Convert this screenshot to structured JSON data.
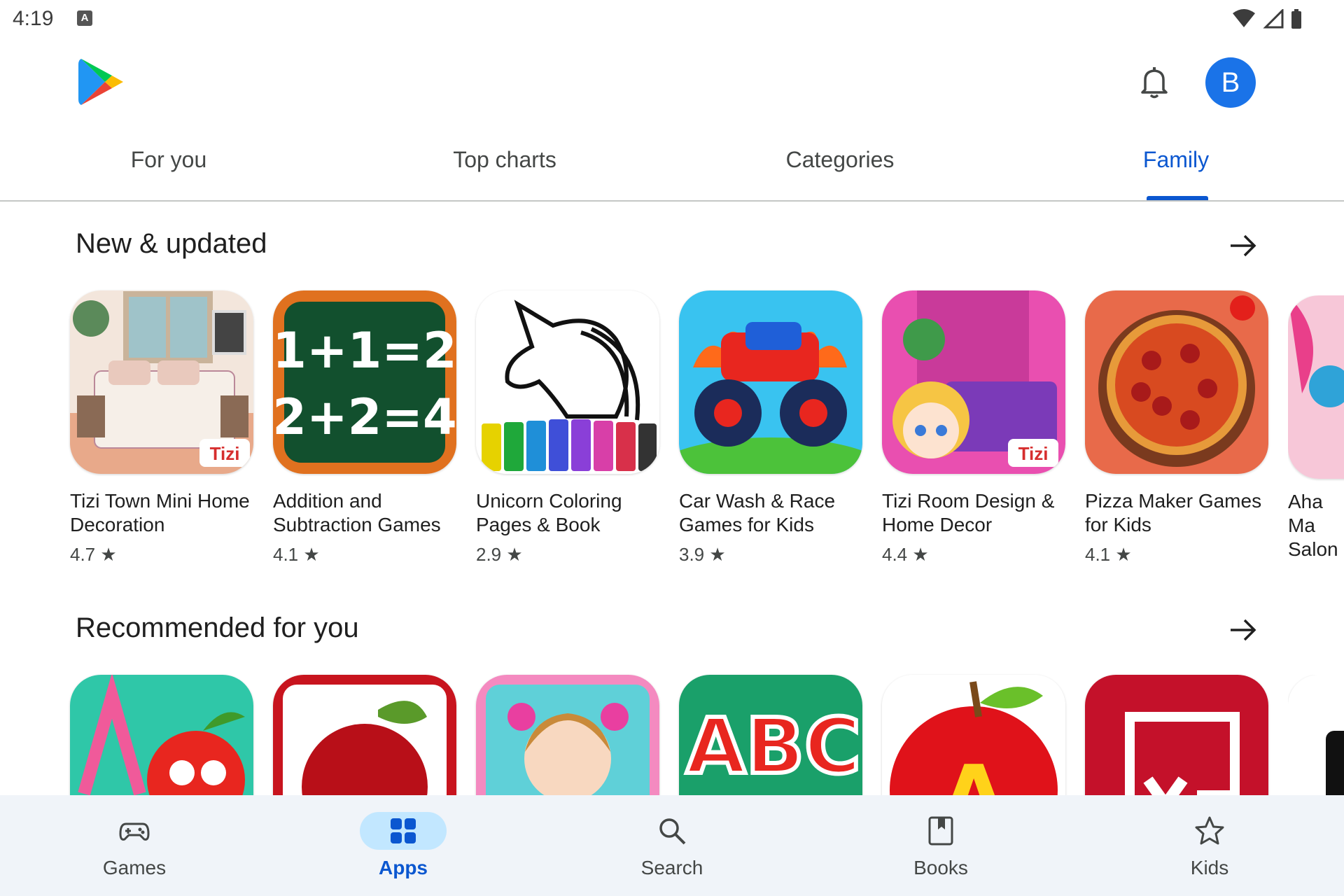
{
  "status": {
    "time": "4:19",
    "notif_letter": "A"
  },
  "header": {
    "avatar_letter": "B"
  },
  "tabs": [
    {
      "label": "For you"
    },
    {
      "label": "Top charts"
    },
    {
      "label": "Categories"
    },
    {
      "label": "Family"
    }
  ],
  "section1": {
    "title": "New & updated",
    "apps": [
      {
        "name": "Tizi Town Mini Home Decoration",
        "rating": "4.7 ★",
        "badge": "Tizi"
      },
      {
        "name": "Addition and Subtraction Games",
        "rating": "4.1 ★",
        "line1": "1+1=2",
        "line2": "2+2=4"
      },
      {
        "name": "Unicorn Coloring Pages & Book",
        "rating": "2.9 ★"
      },
      {
        "name": "Car Wash & Race Games for Kids",
        "rating": "3.9 ★"
      },
      {
        "name": "Tizi Room Design & Home Decor",
        "rating": "4.4 ★",
        "badge": "Tizi"
      },
      {
        "name": "Pizza Maker Games for Kids",
        "rating": "4.1 ★"
      },
      {
        "name": "Aha Ma Salon",
        "rating": ""
      }
    ]
  },
  "section2": {
    "title": "Recommended for you",
    "apps": [
      {
        "name": ""
      },
      {
        "name": ""
      },
      {
        "name": ""
      },
      {
        "name": "",
        "letters": "ABC"
      },
      {
        "name": "",
        "letter": "A"
      },
      {
        "name": ""
      },
      {
        "name": ""
      }
    ]
  },
  "bottom_nav": [
    {
      "label": "Games",
      "icon": "gamepad-icon"
    },
    {
      "label": "Apps",
      "icon": "apps-grid-icon"
    },
    {
      "label": "Search",
      "icon": "search-icon"
    },
    {
      "label": "Books",
      "icon": "book-icon"
    },
    {
      "label": "Kids",
      "icon": "star-icon"
    }
  ],
  "colors": {
    "accent": "#0b57d0",
    "avatar": "#1a73e8",
    "nav_bg": "#f0f4f9",
    "active_pill": "#c2e7ff"
  }
}
